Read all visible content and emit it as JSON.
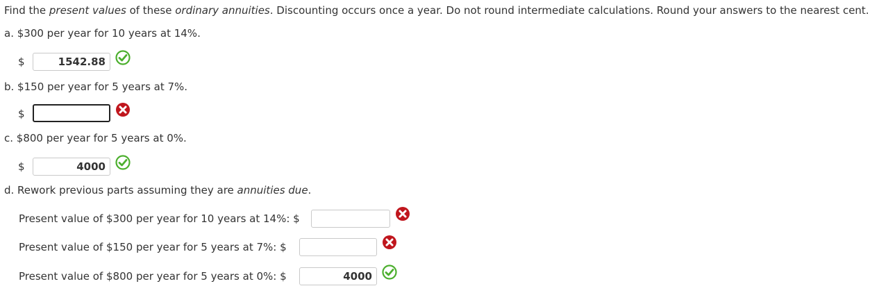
{
  "instructions": {
    "p1": "Find the ",
    "em1": "present values",
    "p2": " of these ",
    "em2": "ordinary annuities",
    "p3": ". Discounting occurs once a year. Do not round intermediate calculations. Round your answers to the nearest cent."
  },
  "parts": {
    "a": {
      "label": "a. $300 per year for 10 years at 14%.",
      "currency": "$",
      "value": "1542.88",
      "status": "correct"
    },
    "b": {
      "label": "b. $150 per year for 5 years at 7%.",
      "currency": "$",
      "value": "",
      "status": "incorrect"
    },
    "c": {
      "label": "c. $800 per year for 5 years at 0%.",
      "currency": "$",
      "value": "4000",
      "status": "correct"
    },
    "d": {
      "label_prefix": "d. Rework previous parts assuming they are ",
      "label_em": "annuities due",
      "label_suffix": ".",
      "items": [
        {
          "label": "Present value of $300 per year for 10 years at 14%: $",
          "value": "",
          "status": "incorrect"
        },
        {
          "label": "Present value of $150 per year for 5 years at 7%: $",
          "value": "",
          "status": "incorrect"
        },
        {
          "label": "Present value of $800 per year for 5 years at 0%: $",
          "value": "4000",
          "status": "correct"
        }
      ]
    }
  },
  "colors": {
    "correct": "#4caf2e",
    "incorrect": "#c0161d"
  }
}
